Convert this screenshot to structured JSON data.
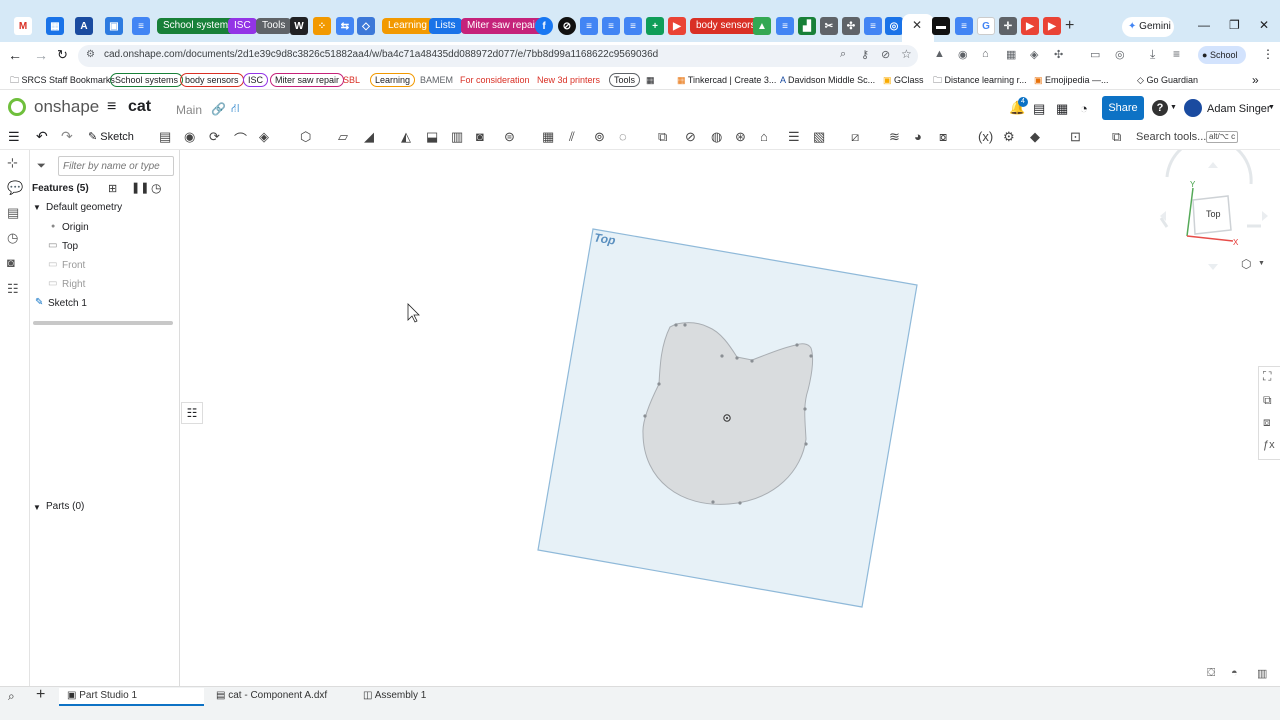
{
  "browser": {
    "url": "cad.onshape.com/documents/2d1e39c9d8c3826c51882aa4/w/ba4c71a48435dd088972d077/e/7bb8d99a1168622c9569036d",
    "tab_labels": [
      "School systems",
      "ISC",
      "Tools",
      "Learning",
      "Lists",
      "Miter saw repair",
      "body sensors"
    ],
    "gemini_label": "Gemini",
    "profile_label": "School"
  },
  "bookmarks": {
    "items": [
      "SRCS Staff Bookmarks",
      "School systems",
      "body sensors",
      "ISC",
      "Miter saw repair",
      "SBL",
      "Learning",
      "BAMEM",
      "For consideration",
      "New 3d printers",
      "Tools",
      "Tinkercad | Create 3...",
      "Davidson Middle Sc...",
      "GClass",
      "Distance learning r...",
      "Emojipedia —...",
      "Go Guardian"
    ],
    "overflow": "»"
  },
  "app": {
    "brand": "onshape",
    "doc_title": "cat",
    "branch": "Main",
    "notif_count": "4",
    "share_label": "Share",
    "user_name": "Adam Singer",
    "help_icon": "?"
  },
  "toolbar": {
    "sketch_label": "Sketch",
    "search_label": "Search tools...",
    "search_shortcut": "alt/⌥ c"
  },
  "features": {
    "filter_placeholder": "Filter by name or type",
    "header": "Features (5)",
    "items": [
      "Default geometry",
      "Origin",
      "Top",
      "Front",
      "Right",
      "Sketch 1"
    ],
    "parts_header": "Parts (0)"
  },
  "viewport": {
    "plane_label": "Top",
    "viewcube_label": "Top",
    "axis_x": "X",
    "axis_y": "Y"
  },
  "bottom_tabs": [
    "Part Studio 1",
    "cat - Component A.dxf",
    "Assembly 1"
  ],
  "colors": {
    "accent": "#0d72c5",
    "tabstrip": "#d6e9f7",
    "plane_fill": "#e7f1f7",
    "plane_stroke": "#8fb9d9",
    "shape_fill": "#d9dcde"
  }
}
